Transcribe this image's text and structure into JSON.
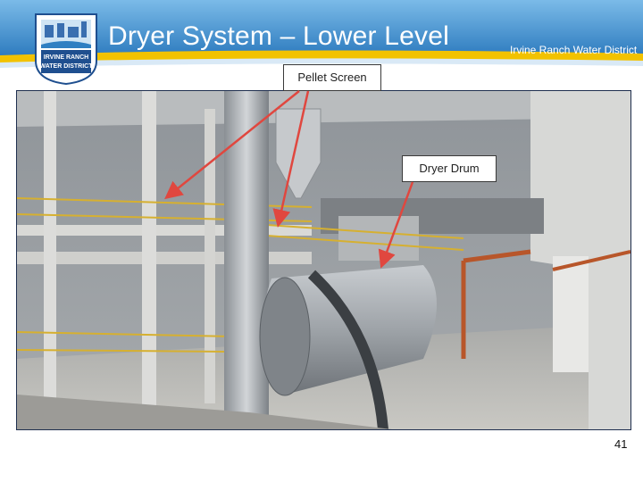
{
  "slide": {
    "title": "Dryer System – Lower Level",
    "organization": "Irvine Ranch Water District",
    "page_number": "41"
  },
  "logo": {
    "line1": "IRVINE RANCH",
    "line2": "WATER DISTRICT"
  },
  "callouts": {
    "pellet_screen": "Pellet Screen",
    "dryer_drum": "Dryer Drum"
  },
  "colors": {
    "banner_top": "#5fa9de",
    "banner_bottom": "#2f7fc2",
    "stripe": "#f2c200",
    "arrow": "#e0473f"
  }
}
